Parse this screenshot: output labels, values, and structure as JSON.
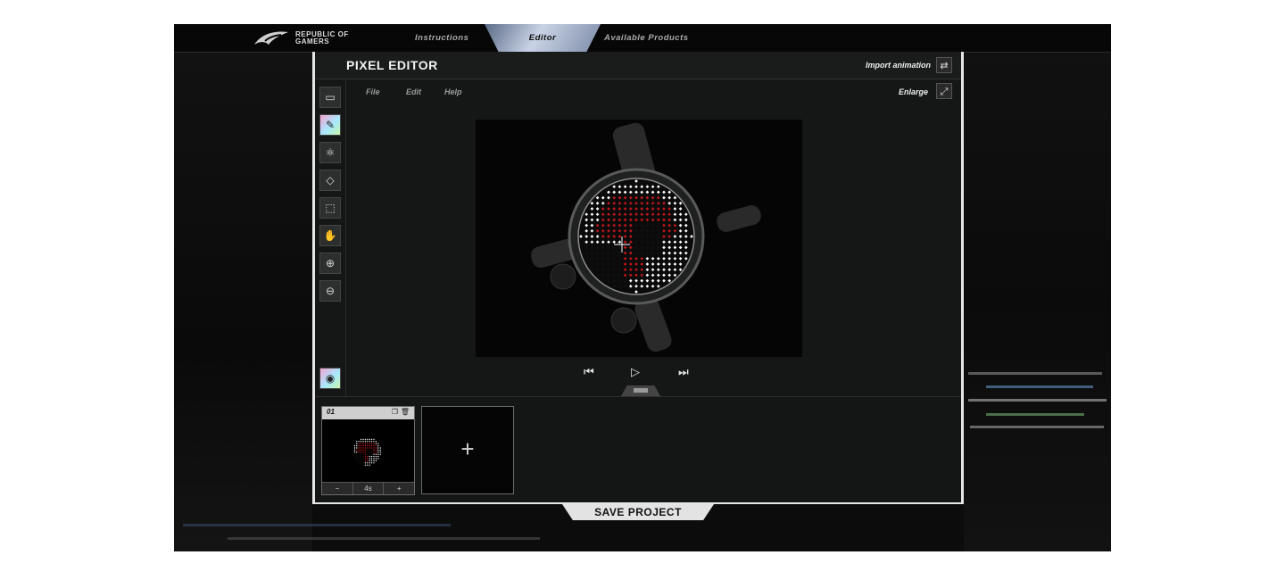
{
  "nav": {
    "logo_text": "REPUBLIC OF GAMERS",
    "tabs": [
      {
        "label": "Instructions"
      },
      {
        "label": "Editor"
      },
      {
        "label": "Available Products"
      }
    ]
  },
  "panel": {
    "title": "PIXEL EDITOR",
    "import_label": "Import animation",
    "enlarge_label": "Enlarge",
    "menu": [
      {
        "label": "File"
      },
      {
        "label": "Edit"
      },
      {
        "label": "Help"
      }
    ]
  },
  "tools": [
    {
      "icon": "canvas-size-icon"
    },
    {
      "icon": "pencil-icon",
      "active": true
    },
    {
      "icon": "color-bucket-icon"
    },
    {
      "icon": "eraser-icon"
    },
    {
      "icon": "selection-icon"
    },
    {
      "icon": "hand-icon"
    },
    {
      "icon": "zoom-in-icon"
    },
    {
      "icon": "zoom-out-icon"
    },
    {
      "icon": "preview-eye-icon"
    }
  ],
  "timeline": {
    "frames": [
      {
        "number": "01",
        "duration": "4s"
      }
    ],
    "add_label": "+"
  },
  "save_label": "SAVE PROJECT",
  "colors": {
    "accent_red": "#c0171b",
    "led_white": "#ffffff",
    "panel_border": "#e6e6e6"
  }
}
